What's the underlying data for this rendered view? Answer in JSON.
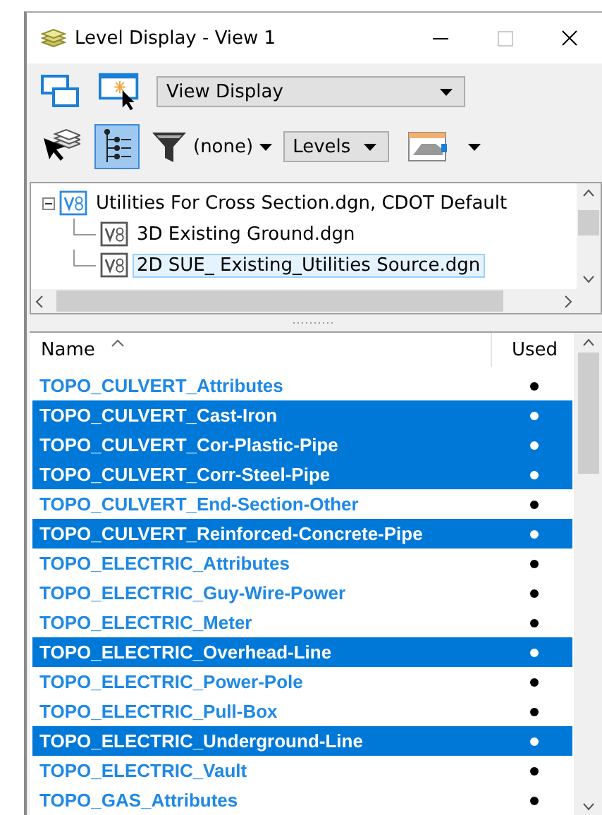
{
  "window": {
    "title": "Level Display - View 1"
  },
  "toolbar": {
    "view_dropdown": {
      "value": "View Display"
    },
    "hierarchy_button": {
      "pressed": true
    },
    "filter": {
      "value": "(none)"
    },
    "mode_dropdown": {
      "value": "Levels"
    }
  },
  "tree": {
    "items": [
      {
        "label": "Utilities For Cross Section.dgn, CDOT Default",
        "expanded": true,
        "selected": false,
        "children": [
          {
            "label": "3D Existing Ground.dgn",
            "selected": false
          },
          {
            "label": "2D SUE_ Existing_Utilities Source.dgn",
            "selected": true
          }
        ]
      }
    ]
  },
  "levels": {
    "columns": [
      "Name",
      "Used"
    ],
    "rows": [
      {
        "name": "TOPO_CULVERT_Attributes",
        "used": true,
        "selected": false
      },
      {
        "name": "TOPO_CULVERT_Cast-Iron",
        "used": true,
        "selected": true
      },
      {
        "name": "TOPO_CULVERT_Cor-Plastic-Pipe",
        "used": true,
        "selected": true
      },
      {
        "name": "TOPO_CULVERT_Corr-Steel-Pipe",
        "used": true,
        "selected": true
      },
      {
        "name": "TOPO_CULVERT_End-Section-Other",
        "used": true,
        "selected": false
      },
      {
        "name": "TOPO_CULVERT_Reinforced-Concrete-Pipe",
        "used": true,
        "selected": true
      },
      {
        "name": "TOPO_ELECTRIC_Attributes",
        "used": true,
        "selected": false
      },
      {
        "name": "TOPO_ELECTRIC_Guy-Wire-Power",
        "used": true,
        "selected": false
      },
      {
        "name": "TOPO_ELECTRIC_Meter",
        "used": true,
        "selected": false
      },
      {
        "name": "TOPO_ELECTRIC_Overhead-Line",
        "used": true,
        "selected": true
      },
      {
        "name": "TOPO_ELECTRIC_Power-Pole",
        "used": true,
        "selected": false
      },
      {
        "name": "TOPO_ELECTRIC_Pull-Box",
        "used": true,
        "selected": false
      },
      {
        "name": "TOPO_ELECTRIC_Underground-Line",
        "used": true,
        "selected": true
      },
      {
        "name": "TOPO_ELECTRIC_Vault",
        "used": true,
        "selected": false
      },
      {
        "name": "TOPO_GAS_Attributes",
        "used": true,
        "selected": false
      }
    ]
  }
}
